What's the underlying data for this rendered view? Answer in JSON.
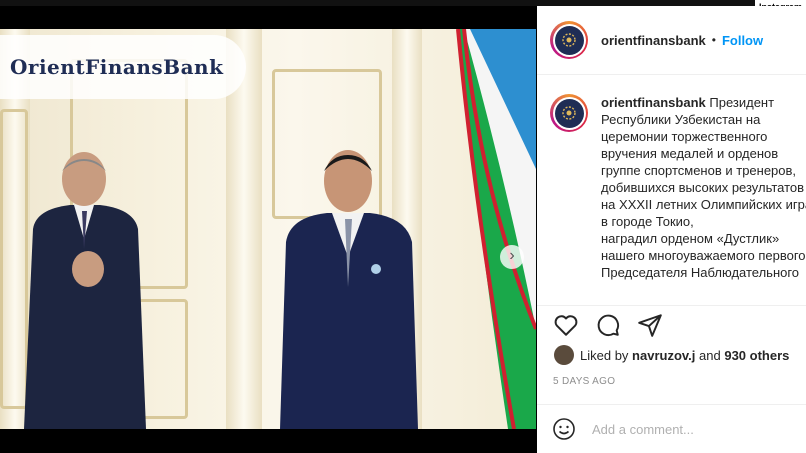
{
  "badge": "Instagram",
  "post": {
    "brand_overlay": "OrientFinansBank",
    "carousel": {
      "slides": 2,
      "active": 1
    },
    "next_icon": "chevron-right-icon"
  },
  "header": {
    "username": "orientfinansbank",
    "separator": "•",
    "follow_label": "Follow"
  },
  "caption": {
    "username": "orientfinansbank",
    "lines": [
      "Президент",
      "Республики Узбекистан на",
      "церемонии торжественного",
      "вручения медалей и орденов",
      "группе спортсменов и тренеров,",
      "добившихся высоких результатов",
      "на XXXII летних Олимпийских играх",
      "в городе Токио,",
      "наградил орденом «Дустлик»",
      "нашего многоуважаемого первого",
      "Председателя Наблюдательного"
    ]
  },
  "actions": {
    "like_icon": "heart-icon",
    "comment_icon": "comment-icon",
    "share_icon": "paper-plane-icon"
  },
  "likes": {
    "prefix": "Liked by",
    "user": "navruzov.j",
    "mid": "and",
    "others": "930 others"
  },
  "time": "5 DAYS AGO",
  "comment": {
    "emoji_icon": "smiley-icon",
    "placeholder": "Add a comment..."
  },
  "colors": {
    "accent": "#0095f6",
    "brand_navy": "#1f2d55",
    "text": "#262626",
    "muted": "#8e8e8e"
  }
}
